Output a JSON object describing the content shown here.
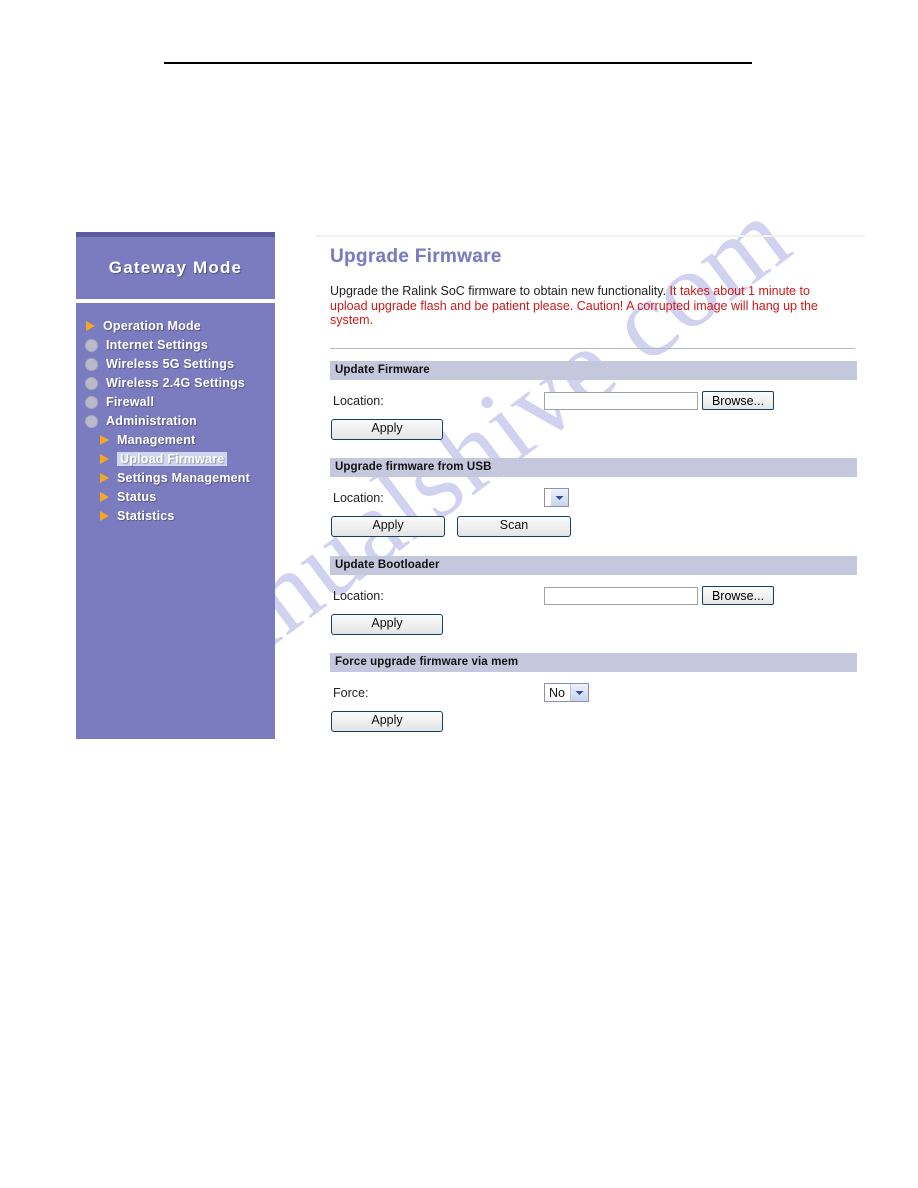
{
  "watermark": {
    "text": "manualshive.com"
  },
  "sidebar": {
    "title": "Gateway Mode",
    "items": [
      {
        "label": "Operation Mode",
        "icon": "triangle-icon",
        "level": "top",
        "selected": false
      },
      {
        "label": "Internet Settings",
        "icon": "circle-icon",
        "level": "top",
        "selected": false
      },
      {
        "label": "Wireless 5G Settings",
        "icon": "circle-icon",
        "level": "top",
        "selected": false
      },
      {
        "label": "Wireless 2.4G Settings",
        "icon": "circle-icon",
        "level": "top",
        "selected": false
      },
      {
        "label": "Firewall",
        "icon": "circle-icon",
        "level": "top",
        "selected": false
      },
      {
        "label": "Administration",
        "icon": "circle-icon",
        "level": "top",
        "selected": false
      },
      {
        "label": "Management",
        "icon": "triangle-icon",
        "level": "sub",
        "selected": false
      },
      {
        "label": "Upload Firmware",
        "icon": "triangle-icon",
        "level": "sub",
        "selected": true
      },
      {
        "label": "Settings Management",
        "icon": "triangle-icon",
        "level": "sub",
        "selected": false
      },
      {
        "label": "Status",
        "icon": "triangle-icon",
        "level": "sub",
        "selected": false
      },
      {
        "label": "Statistics",
        "icon": "triangle-icon",
        "level": "sub",
        "selected": false
      }
    ]
  },
  "content": {
    "title": "Upgrade Firmware",
    "description_normal": "Upgrade the Ralink SoC firmware to obtain new functionality. ",
    "description_warning": "It takes about 1 minute to upload upgrade flash and be patient please. Caution! A corrupted image will hang up the system.",
    "sections": {
      "update_firmware": {
        "title": "Update Firmware",
        "location_label": "Location:",
        "location_value": "",
        "location_placeholder": "",
        "browse_label": "Browse...",
        "apply_label": "Apply"
      },
      "upgrade_from_usb": {
        "title": "Upgrade firmware from USB",
        "location_label": "Location:",
        "location_selected": "",
        "apply_label": "Apply",
        "scan_label": "Scan"
      },
      "update_bootloader": {
        "title": "Update Bootloader",
        "location_label": "Location:",
        "location_value": "",
        "location_placeholder": "",
        "browse_label": "Browse...",
        "apply_label": "Apply"
      },
      "force_upgrade": {
        "title": "Force upgrade firmware via mem",
        "force_label": "Force:",
        "force_selected": "No",
        "apply_label": "Apply"
      }
    }
  },
  "colors": {
    "sidebar_bg": "#7b7bc0",
    "sidebar_topbar": "#5b5ba0",
    "section_bar": "#c5c7dd",
    "title": "#7b7bc0",
    "warning_text": "#d01818",
    "bullet_triangle": "#f5a623",
    "bullet_circle": "#b9b9c9",
    "selected_highlight": "#cfd7f0"
  }
}
